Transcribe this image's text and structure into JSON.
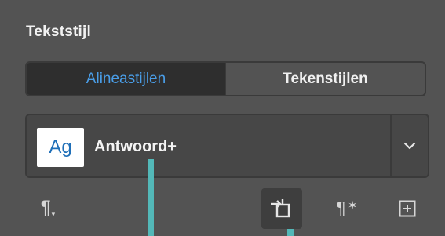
{
  "panel": {
    "title": "Tekststijl"
  },
  "tabs": [
    {
      "label": "Alineastijlen",
      "active": true
    },
    {
      "label": "Tekenstijlen",
      "active": false
    }
  ],
  "style_select": {
    "swatch_text": "Ag",
    "current_value": "Antwoord+",
    "dropdown_icon": "chevron-down-icon"
  },
  "toolbar": {
    "paragraph_menu_icon": "pilcrow-icon",
    "paragraph_menu_glyph": "¶",
    "apply_style_icon": "apply-style-icon",
    "clear_overrides_icon": "pilcrow-clear-icon",
    "clear_overrides_glyph": "¶",
    "new_style_icon": "plus-square-icon"
  },
  "colors": {
    "active_tab_text": "#4a9ee8",
    "swatch_text": "#1f6fb8",
    "guide_line": "#53b8b8",
    "panel_background": "#535353"
  }
}
